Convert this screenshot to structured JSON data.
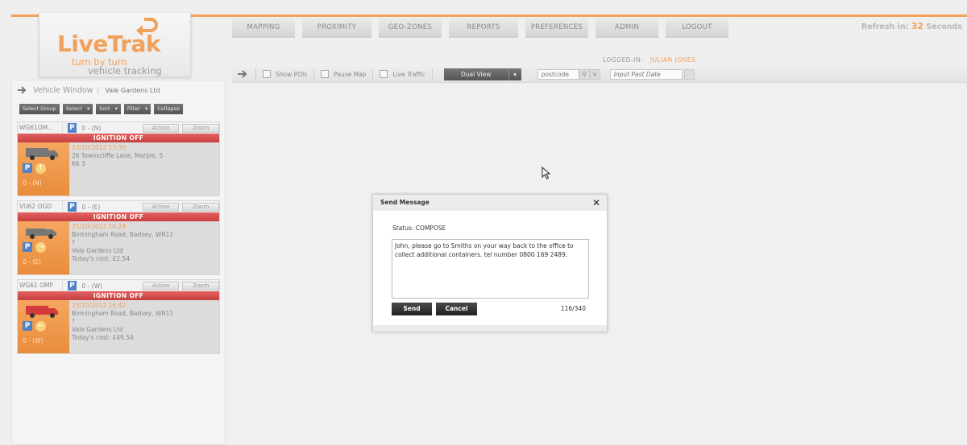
{
  "logo": {
    "main": "LiveTrak",
    "line1": "turn by turn",
    "line2": "vehicle tracking"
  },
  "nav": [
    "MAPPING",
    "PROXIMITY",
    "GEO-ZONES",
    "REPORTS",
    "PREFERENCES",
    "ADMIN",
    "LOGOUT"
  ],
  "refresh": {
    "prefix": "Refresh in:",
    "value": "32",
    "suffix": "Seconds"
  },
  "logged_in": {
    "label": "LOGGED-IN:",
    "user": "JULIAN JONES"
  },
  "toolbar": {
    "show_pois": "Show POIs",
    "pause_map": "Pause Map",
    "live_traffic": "Live Traffic",
    "view_select": "Dual View",
    "search_value": "postcode",
    "date_placeholder": "Input Past Date"
  },
  "vehicle_window": {
    "title": "Vehicle Window",
    "group": "Vale Gardens Ltd",
    "actions": [
      "Select Group",
      "Select",
      "Sort",
      "Filter",
      "Collapse"
    ]
  },
  "vehicles": [
    {
      "reg": "WG61OM...",
      "speed": "0 - (N)",
      "action": "Action",
      "zoom": "Zoom",
      "status": "IGNITION OFF",
      "timestamp": "23/10/2012 13:39",
      "addr1": "26 Townscliffe Lane, Marple, S",
      "addr2": "K6 3",
      "addr3": "",
      "cost": "",
      "speed2": "0 - (N)",
      "van_color": "#777777",
      "dir": "↑"
    },
    {
      "reg": "VU62 OGD",
      "speed": "0 - (E)",
      "action": "Action",
      "zoom": "Zoom",
      "status": "IGNITION OFF",
      "timestamp": "25/10/2012 16:24",
      "addr1": "Birmingham Road, Badsey, WR11",
      "addr2": "?",
      "addr3": "Vale Gardens Ltd",
      "cost": "Today's cost: £2.54",
      "speed2": "0 - (E)",
      "van_color": "#777777",
      "dir": "→"
    },
    {
      "reg": "WG61 OMP",
      "speed": "0 - (W)",
      "action": "Action",
      "zoom": "Zoom",
      "status": "IGNITION OFF",
      "timestamp": "25/10/2012 16:42",
      "addr1": "Birmingham Road, Badsey, WR11",
      "addr2": "?",
      "addr3": "Vale Gardens Ltd",
      "cost": "Today's cost: £49.54",
      "speed2": "0 - (W)",
      "van_color": "#d33a3a",
      "dir": "←"
    }
  ],
  "modal": {
    "title": "Send Message",
    "close": "✕",
    "status": "Status: COMPOSE",
    "message": "John, please go to Smiths on your way back to the office to collect additional containers. tel number 0800 169 2489.",
    "send": "Send",
    "cancel": "Cancel",
    "count": "116/340"
  }
}
